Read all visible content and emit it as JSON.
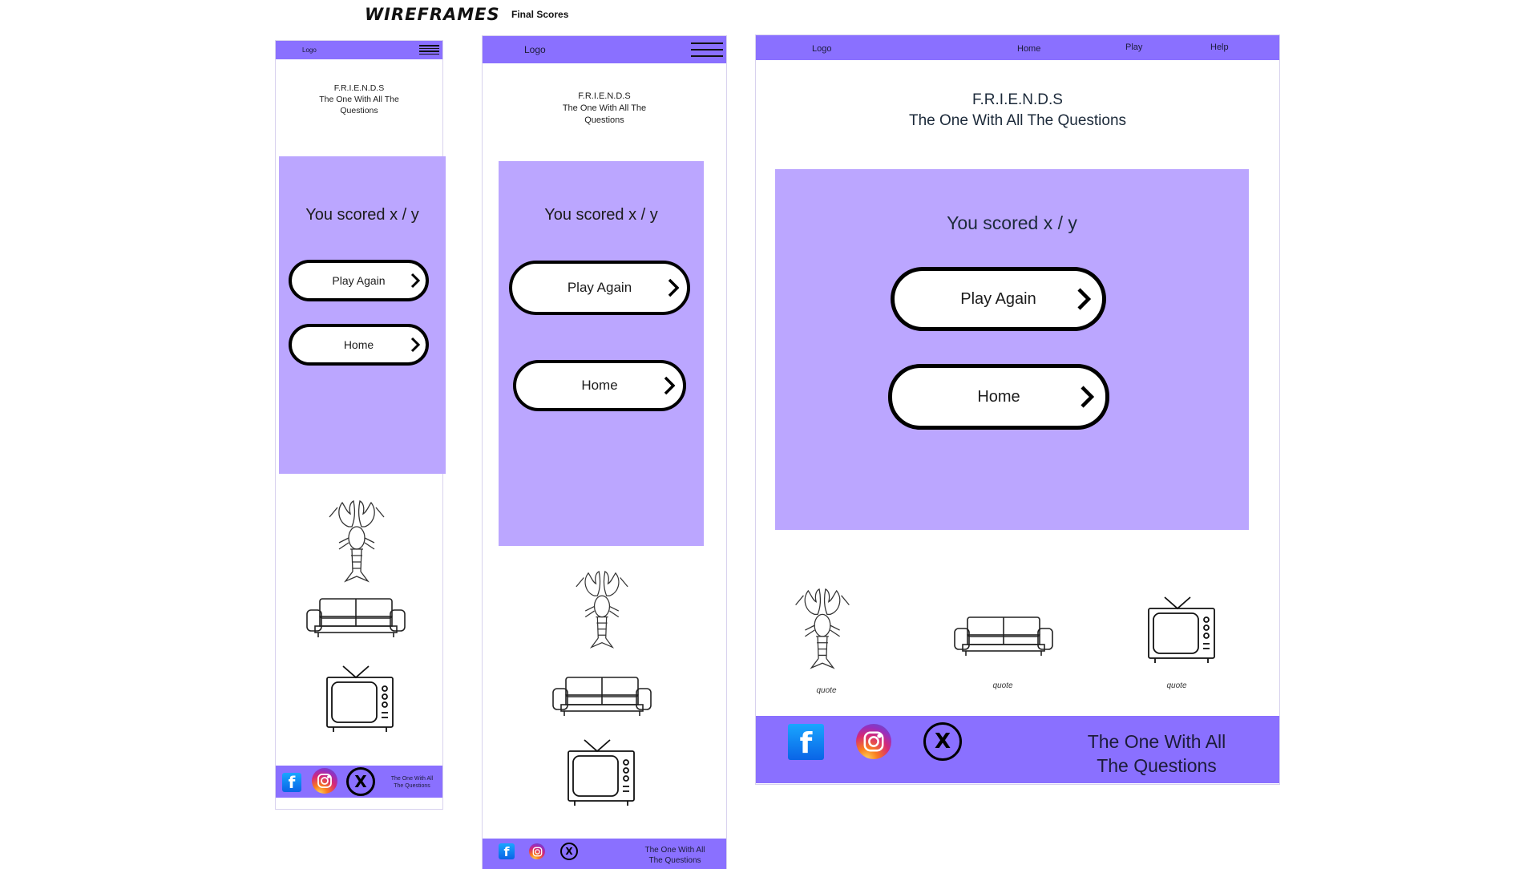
{
  "header": {
    "title": "WIREFRAMES",
    "subtitle": "Final Scores"
  },
  "site": {
    "logo": "Logo",
    "title_line1": "F.R.I.E.N.D.S",
    "title_line2": "The  One With All The Questions",
    "title_line2a": "The  One With All The",
    "title_line2b": "Questions"
  },
  "nav": {
    "home": "Home",
    "play": "Play",
    "help": "Help"
  },
  "score_text": "You scored x / y",
  "buttons": {
    "play_again": "Play Again",
    "home": "Home"
  },
  "quotes": [
    "quote",
    "quote",
    "quote"
  ],
  "footer": {
    "line1": "The One With All",
    "line2": "The Questions"
  },
  "colors": {
    "nav": "#8a70ff",
    "card": "#bba6ff",
    "footer": "#8a70ff"
  },
  "icons": [
    "lobster-icon",
    "couch-icon",
    "tv-icon",
    "facebook-icon",
    "instagram-icon",
    "x-icon",
    "hamburger-menu-icon",
    "chevron-right-icon"
  ]
}
